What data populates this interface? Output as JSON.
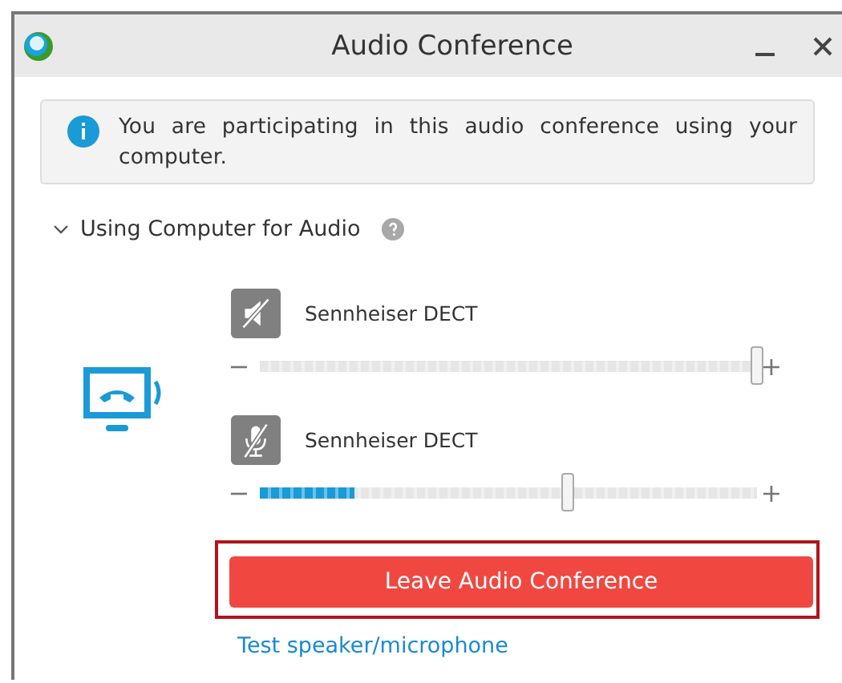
{
  "window": {
    "title": "Audio Conference"
  },
  "info": {
    "text": "You are participating in this audio conference using your computer."
  },
  "section": {
    "title": "Using Computer for Audio",
    "expanded": true
  },
  "devices": [
    {
      "kind": "speaker",
      "name": "Sennheiser DECT",
      "minus": "−",
      "plus": "+",
      "level": 1.0
    },
    {
      "kind": "microphone",
      "name": "Sennheiser DECT",
      "minus": "−",
      "plus": "+",
      "level": 0.62,
      "input": {
        "level": 0.19
      }
    }
  ],
  "leave_button": {
    "label": "Leave Audio Conference",
    "focused": true
  },
  "test_link": "Test speaker/microphone"
}
